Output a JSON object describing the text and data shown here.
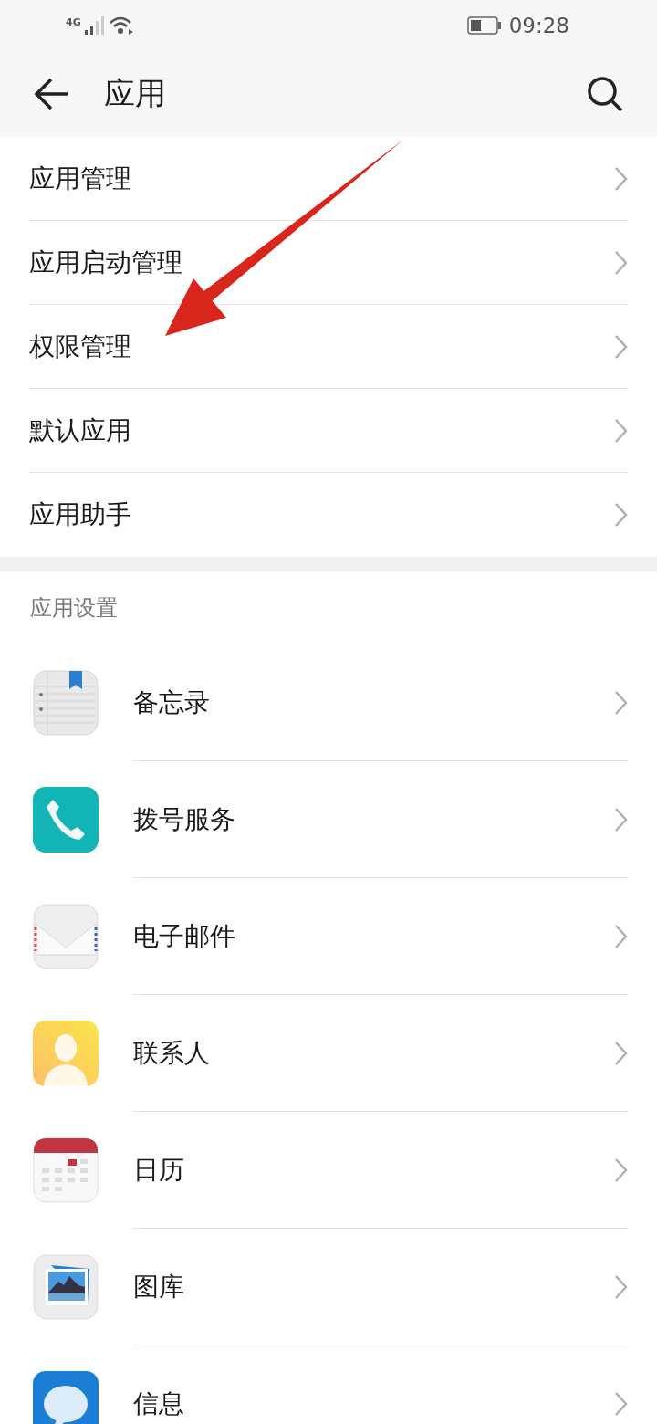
{
  "status_bar": {
    "network": "4G",
    "time": "09:28"
  },
  "header": {
    "title": "应用"
  },
  "menu": [
    {
      "label": "应用管理"
    },
    {
      "label": "应用启动管理"
    },
    {
      "label": "权限管理"
    },
    {
      "label": "默认应用"
    },
    {
      "label": "应用助手"
    }
  ],
  "section": {
    "title": "应用设置",
    "apps": [
      {
        "label": "备忘录",
        "kind": "notes"
      },
      {
        "label": "拨号服务",
        "kind": "phone"
      },
      {
        "label": "电子邮件",
        "kind": "mail"
      },
      {
        "label": "联系人",
        "kind": "contacts"
      },
      {
        "label": "日历",
        "kind": "calendar"
      },
      {
        "label": "图库",
        "kind": "gallery"
      },
      {
        "label": "信息",
        "kind": "messages"
      }
    ]
  }
}
